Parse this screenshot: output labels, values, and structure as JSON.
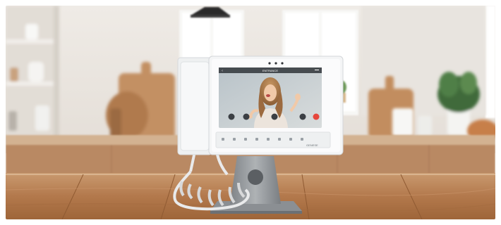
{
  "scene": {
    "device": {
      "brand_label": "GENESE",
      "screen_title": "ENTRANCE",
      "control_icons": [
        "phone-icon",
        "key-icon",
        "camera-icon",
        "speaker-icon",
        "mute-icon",
        "menu-icon",
        "settings-icon",
        "home-icon"
      ],
      "call_buttons": [
        "snapshot-icon",
        "unlock-icon",
        "microphone-icon",
        "video-icon",
        "hangup-icon"
      ]
    },
    "colors": {
      "wall": "#ece8e3",
      "counter": "#b98963",
      "tabletop": "#b57d52",
      "device_body": "#f4f5f6",
      "hangup": "#e6463c"
    }
  }
}
